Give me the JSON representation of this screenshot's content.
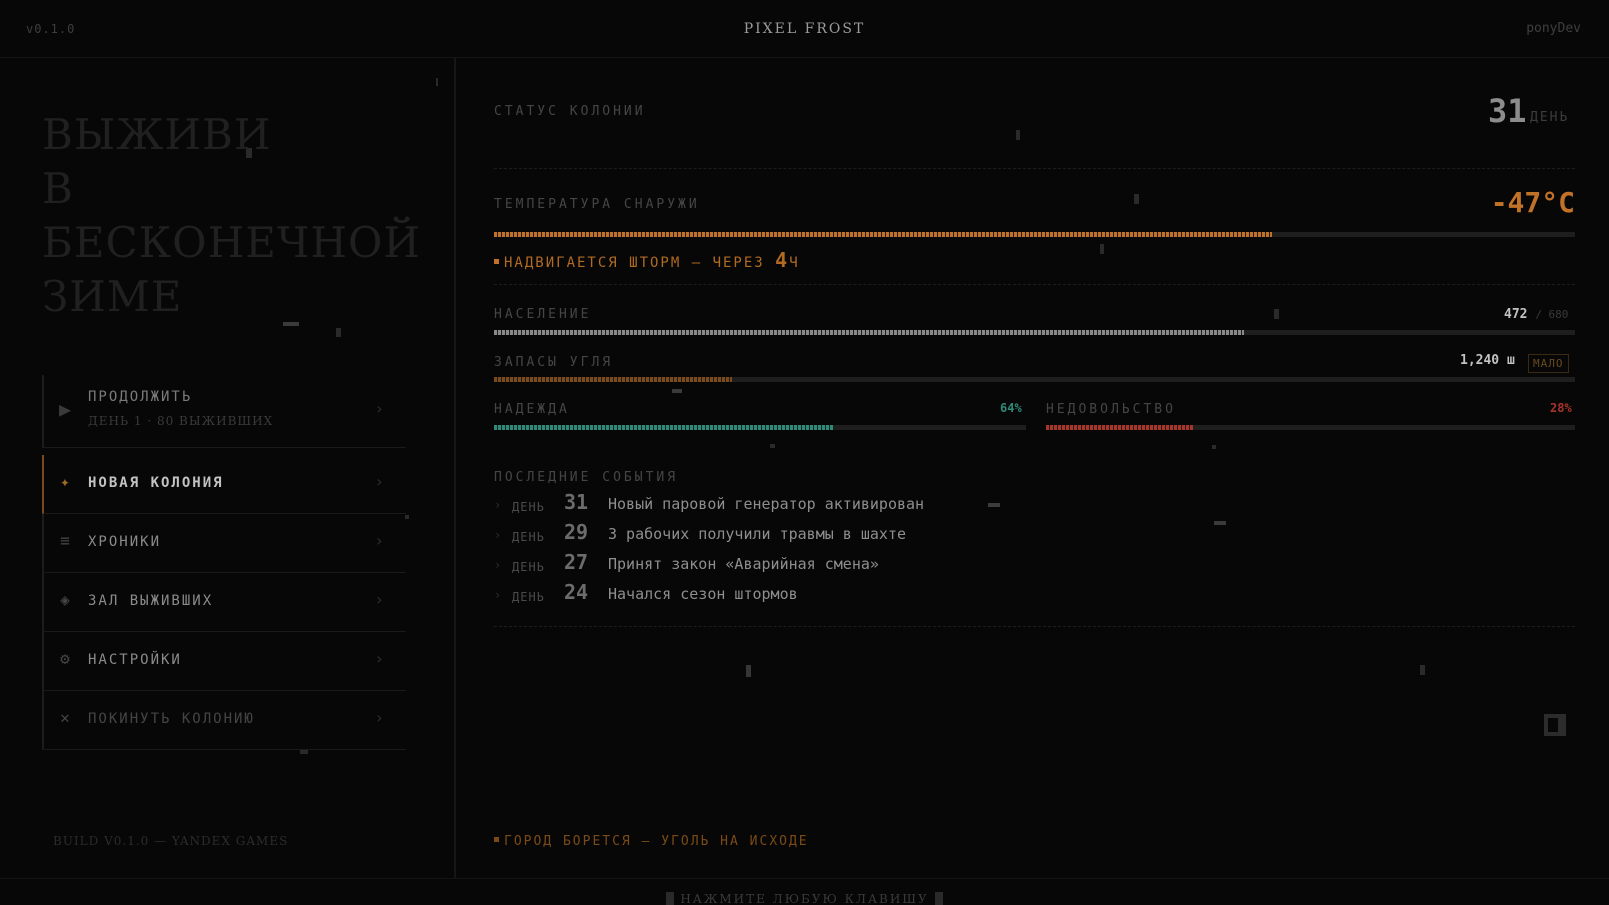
{
  "header": {
    "version": "v0.1.0",
    "title": "PIXEL FROST",
    "author": "ponyDev"
  },
  "hero": {
    "lines": [
      "ВЫЖИВИ",
      "В",
      "БЕСКОНЕЧНОЙ",
      "ЗИМЕ"
    ]
  },
  "menu": {
    "items": [
      {
        "label": "ПРОДОЛЖИТЬ",
        "sub": "ДЕНЬ 1 · 80 ВЫЖИВШИХ",
        "icon": "play-icon"
      },
      {
        "label": "НОВАЯ КОЛОНИЯ",
        "icon": "spark-icon"
      },
      {
        "label": "ХРОНИКИ",
        "icon": "list-icon"
      },
      {
        "label": "ЗАЛ ВЫЖИВШИХ",
        "icon": "diamond-icon"
      },
      {
        "label": "НАСТРОЙКИ",
        "icon": "gear-icon"
      },
      {
        "label": "ПОКИНУТЬ КОЛОНИЮ",
        "icon": "close-icon"
      }
    ]
  },
  "build": "BUILD V0.1.0 — YANDEX GAMES",
  "status": {
    "title": "СТАТУС КОЛОНИИ",
    "day": "31",
    "day_label": "ДЕНЬ",
    "temperature": {
      "label": "ТЕМПЕРАТУРА СНАРУЖИ",
      "value": "-47°C",
      "fill": 0.72
    },
    "warning": {
      "text": "НАДВИГАЕТСЯ ШТОРМ — ЧЕРЕЗ",
      "hours": "4",
      "unit": "Ч"
    },
    "population": {
      "label": "НАСЕЛЕНИЕ",
      "value": "472",
      "max": "/ 680",
      "fill": 0.694
    },
    "coal": {
      "label": "ЗАПАСЫ УГЛЯ",
      "value": "1,240 ш",
      "badge": "МАЛО",
      "fill": 0.22
    },
    "hope": {
      "label": "НАДЕЖДА",
      "value": "64%",
      "fill": 0.64
    },
    "discontent": {
      "label": "НЕДОВОЛЬСТВО",
      "value": "28%",
      "fill": 0.28
    }
  },
  "events": {
    "title": "ПОСЛЕДНИЕ СОБЫТИЯ",
    "day_label": "ДЕНЬ",
    "items": [
      {
        "day": "31",
        "text": "Новый паровой генератор активирован"
      },
      {
        "day": "29",
        "text": "3 рабочих получили травмы в шахте"
      },
      {
        "day": "27",
        "text": "Принят закон «Аварийная смена»"
      },
      {
        "day": "24",
        "text": "Начался сезон штормов"
      }
    ]
  },
  "footer": {
    "status": "ГОРОД БОРЕТСЯ — УГОЛЬ НА ИСХОДЕ",
    "prompt": "НАЖМИТЕ ЛЮБУЮ КЛАВИШУ"
  },
  "colors": {
    "accent": "#c27228",
    "hope": "#2f8a78",
    "discontent": "#a8342a",
    "population": "#8a8a8a",
    "coal": "#7a4a1c"
  }
}
